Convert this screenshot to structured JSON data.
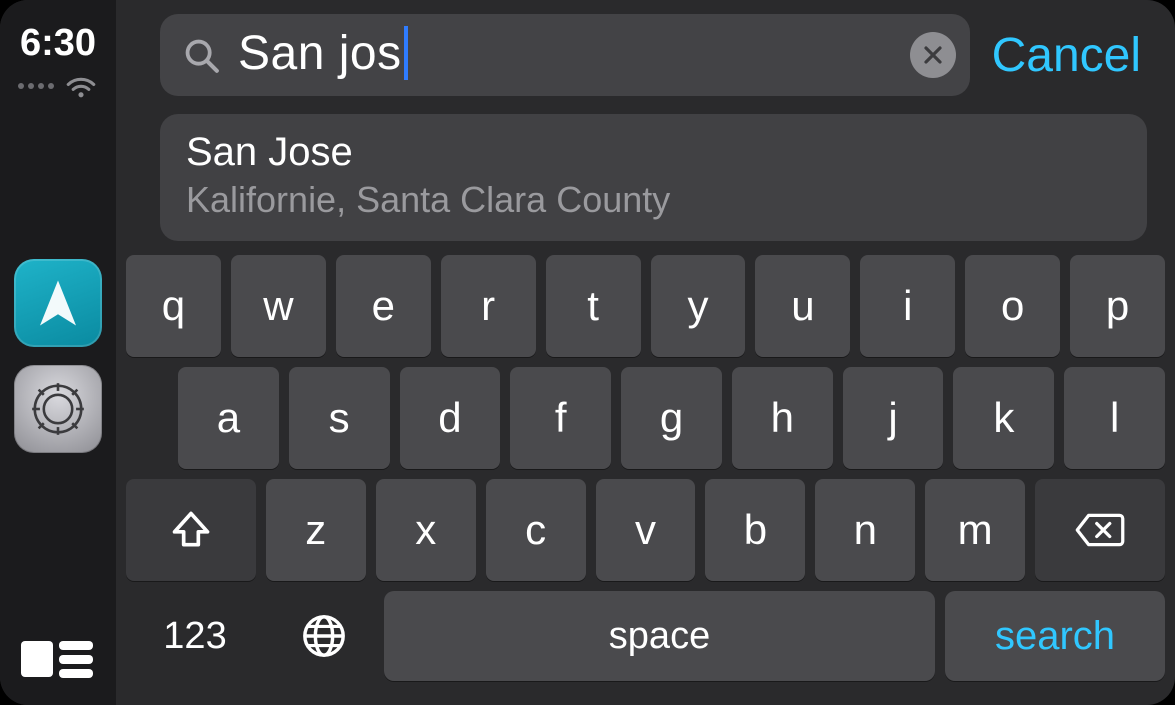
{
  "status": {
    "time": "6:30"
  },
  "search": {
    "query": "San jos",
    "cancel_label": "Cancel"
  },
  "suggestion": {
    "title": "San Jose",
    "subtitle": "Kalifornie, Santa Clara County"
  },
  "keyboard": {
    "row1": [
      "q",
      "w",
      "e",
      "r",
      "t",
      "y",
      "u",
      "i",
      "o",
      "p"
    ],
    "row2": [
      "a",
      "s",
      "d",
      "f",
      "g",
      "h",
      "j",
      "k",
      "l"
    ],
    "row3": [
      "z",
      "x",
      "c",
      "v",
      "b",
      "n",
      "m"
    ],
    "numeric_label": "123",
    "space_label": "space",
    "search_label": "search"
  }
}
